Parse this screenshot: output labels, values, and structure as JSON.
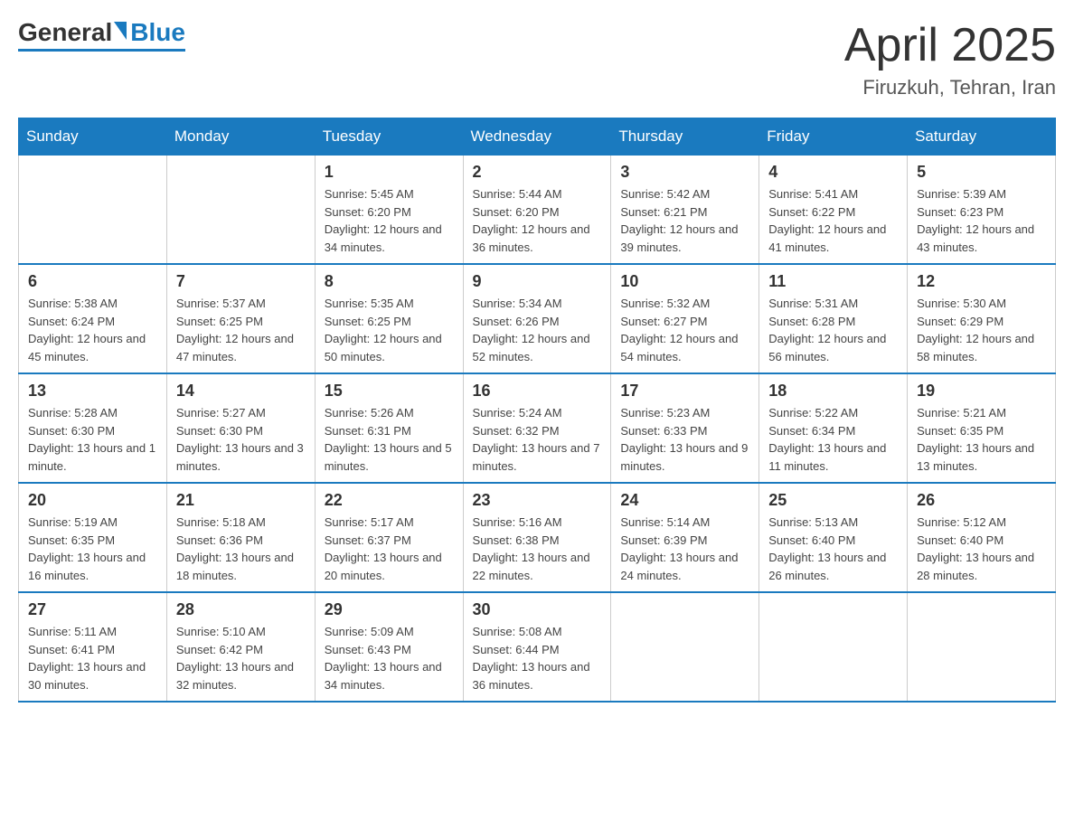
{
  "header": {
    "logo": {
      "general": "General",
      "blue": "Blue"
    },
    "title": "April 2025",
    "location": "Firuzkuh, Tehran, Iran"
  },
  "days_of_week": [
    "Sunday",
    "Monday",
    "Tuesday",
    "Wednesday",
    "Thursday",
    "Friday",
    "Saturday"
  ],
  "weeks": [
    [
      null,
      null,
      {
        "day": "1",
        "sunrise": "Sunrise: 5:45 AM",
        "sunset": "Sunset: 6:20 PM",
        "daylight": "Daylight: 12 hours and 34 minutes."
      },
      {
        "day": "2",
        "sunrise": "Sunrise: 5:44 AM",
        "sunset": "Sunset: 6:20 PM",
        "daylight": "Daylight: 12 hours and 36 minutes."
      },
      {
        "day": "3",
        "sunrise": "Sunrise: 5:42 AM",
        "sunset": "Sunset: 6:21 PM",
        "daylight": "Daylight: 12 hours and 39 minutes."
      },
      {
        "day": "4",
        "sunrise": "Sunrise: 5:41 AM",
        "sunset": "Sunset: 6:22 PM",
        "daylight": "Daylight: 12 hours and 41 minutes."
      },
      {
        "day": "5",
        "sunrise": "Sunrise: 5:39 AM",
        "sunset": "Sunset: 6:23 PM",
        "daylight": "Daylight: 12 hours and 43 minutes."
      }
    ],
    [
      {
        "day": "6",
        "sunrise": "Sunrise: 5:38 AM",
        "sunset": "Sunset: 6:24 PM",
        "daylight": "Daylight: 12 hours and 45 minutes."
      },
      {
        "day": "7",
        "sunrise": "Sunrise: 5:37 AM",
        "sunset": "Sunset: 6:25 PM",
        "daylight": "Daylight: 12 hours and 47 minutes."
      },
      {
        "day": "8",
        "sunrise": "Sunrise: 5:35 AM",
        "sunset": "Sunset: 6:25 PM",
        "daylight": "Daylight: 12 hours and 50 minutes."
      },
      {
        "day": "9",
        "sunrise": "Sunrise: 5:34 AM",
        "sunset": "Sunset: 6:26 PM",
        "daylight": "Daylight: 12 hours and 52 minutes."
      },
      {
        "day": "10",
        "sunrise": "Sunrise: 5:32 AM",
        "sunset": "Sunset: 6:27 PM",
        "daylight": "Daylight: 12 hours and 54 minutes."
      },
      {
        "day": "11",
        "sunrise": "Sunrise: 5:31 AM",
        "sunset": "Sunset: 6:28 PM",
        "daylight": "Daylight: 12 hours and 56 minutes."
      },
      {
        "day": "12",
        "sunrise": "Sunrise: 5:30 AM",
        "sunset": "Sunset: 6:29 PM",
        "daylight": "Daylight: 12 hours and 58 minutes."
      }
    ],
    [
      {
        "day": "13",
        "sunrise": "Sunrise: 5:28 AM",
        "sunset": "Sunset: 6:30 PM",
        "daylight": "Daylight: 13 hours and 1 minute."
      },
      {
        "day": "14",
        "sunrise": "Sunrise: 5:27 AM",
        "sunset": "Sunset: 6:30 PM",
        "daylight": "Daylight: 13 hours and 3 minutes."
      },
      {
        "day": "15",
        "sunrise": "Sunrise: 5:26 AM",
        "sunset": "Sunset: 6:31 PM",
        "daylight": "Daylight: 13 hours and 5 minutes."
      },
      {
        "day": "16",
        "sunrise": "Sunrise: 5:24 AM",
        "sunset": "Sunset: 6:32 PM",
        "daylight": "Daylight: 13 hours and 7 minutes."
      },
      {
        "day": "17",
        "sunrise": "Sunrise: 5:23 AM",
        "sunset": "Sunset: 6:33 PM",
        "daylight": "Daylight: 13 hours and 9 minutes."
      },
      {
        "day": "18",
        "sunrise": "Sunrise: 5:22 AM",
        "sunset": "Sunset: 6:34 PM",
        "daylight": "Daylight: 13 hours and 11 minutes."
      },
      {
        "day": "19",
        "sunrise": "Sunrise: 5:21 AM",
        "sunset": "Sunset: 6:35 PM",
        "daylight": "Daylight: 13 hours and 13 minutes."
      }
    ],
    [
      {
        "day": "20",
        "sunrise": "Sunrise: 5:19 AM",
        "sunset": "Sunset: 6:35 PM",
        "daylight": "Daylight: 13 hours and 16 minutes."
      },
      {
        "day": "21",
        "sunrise": "Sunrise: 5:18 AM",
        "sunset": "Sunset: 6:36 PM",
        "daylight": "Daylight: 13 hours and 18 minutes."
      },
      {
        "day": "22",
        "sunrise": "Sunrise: 5:17 AM",
        "sunset": "Sunset: 6:37 PM",
        "daylight": "Daylight: 13 hours and 20 minutes."
      },
      {
        "day": "23",
        "sunrise": "Sunrise: 5:16 AM",
        "sunset": "Sunset: 6:38 PM",
        "daylight": "Daylight: 13 hours and 22 minutes."
      },
      {
        "day": "24",
        "sunrise": "Sunrise: 5:14 AM",
        "sunset": "Sunset: 6:39 PM",
        "daylight": "Daylight: 13 hours and 24 minutes."
      },
      {
        "day": "25",
        "sunrise": "Sunrise: 5:13 AM",
        "sunset": "Sunset: 6:40 PM",
        "daylight": "Daylight: 13 hours and 26 minutes."
      },
      {
        "day": "26",
        "sunrise": "Sunrise: 5:12 AM",
        "sunset": "Sunset: 6:40 PM",
        "daylight": "Daylight: 13 hours and 28 minutes."
      }
    ],
    [
      {
        "day": "27",
        "sunrise": "Sunrise: 5:11 AM",
        "sunset": "Sunset: 6:41 PM",
        "daylight": "Daylight: 13 hours and 30 minutes."
      },
      {
        "day": "28",
        "sunrise": "Sunrise: 5:10 AM",
        "sunset": "Sunset: 6:42 PM",
        "daylight": "Daylight: 13 hours and 32 minutes."
      },
      {
        "day": "29",
        "sunrise": "Sunrise: 5:09 AM",
        "sunset": "Sunset: 6:43 PM",
        "daylight": "Daylight: 13 hours and 34 minutes."
      },
      {
        "day": "30",
        "sunrise": "Sunrise: 5:08 AM",
        "sunset": "Sunset: 6:44 PM",
        "daylight": "Daylight: 13 hours and 36 minutes."
      },
      null,
      null,
      null
    ]
  ]
}
